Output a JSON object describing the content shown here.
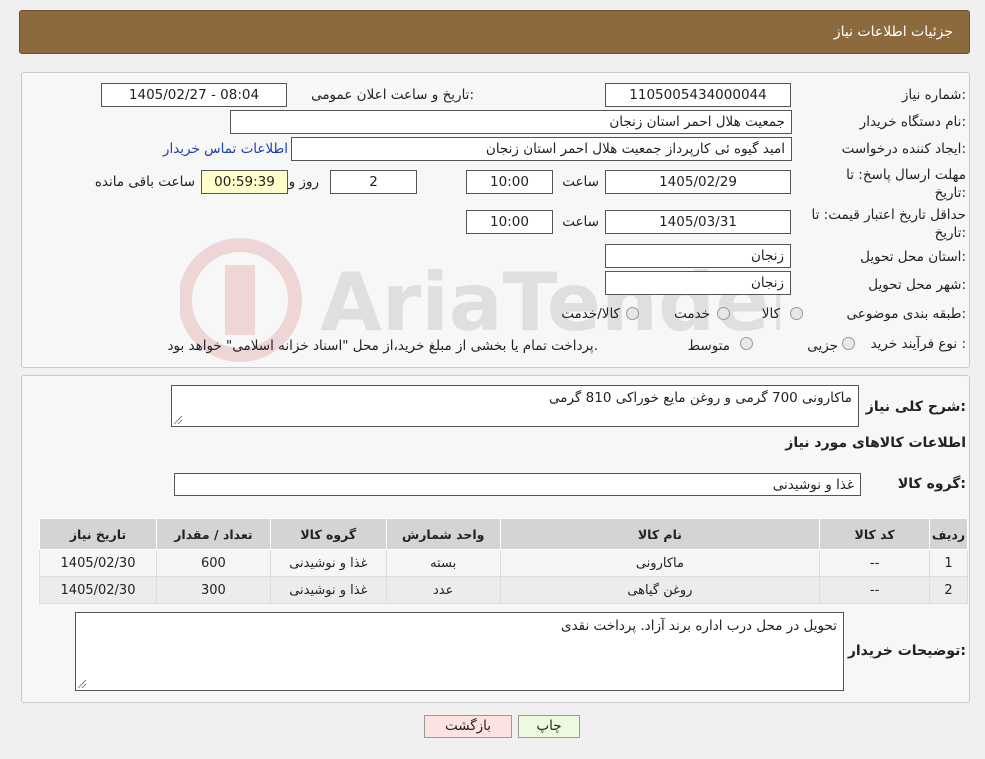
{
  "header": {
    "title": "جزئیات اطلاعات نیاز"
  },
  "form": {
    "need_number_label": "شماره نیاز:",
    "need_number": "1105005434000044",
    "announce_label": "تاریخ و ساعت اعلان عمومی:",
    "announce_value": "1405/02/27 - 08:04",
    "buyer_org_label": "نام دستگاه خریدار:",
    "buyer_org": "جمعیت هلال احمر استان زنجان",
    "requester_label": "ایجاد کننده درخواست:",
    "requester": "امید گیوه ئی کارپرداز  جمعیت هلال احمر استان زنجان",
    "contact_link": "اطلاعات تماس خریدار",
    "deadline_label": "مهلت ارسال پاسخ: تا تاریخ:",
    "deadline_date": "1405/02/29",
    "time_label": "ساعت",
    "deadline_time": "10:00",
    "days_value": "2",
    "days_label": "روز و",
    "remaining_value": "00:59:39",
    "remaining_label": "ساعت باقی مانده",
    "validity_label": "حداقل تاریخ اعتبار قیمت: تا تاریخ:",
    "validity_date": "1405/03/31",
    "validity_time": "10:00",
    "province_label": "استان محل تحویل:",
    "province": "زنجان",
    "city_label": "شهر محل تحویل:",
    "city": "زنجان",
    "category_label": "طبقه بندی موضوعی:",
    "category_options": [
      "کالا",
      "خدمت",
      "کالا/خدمت"
    ],
    "process_label": "نوع فرآیند خرید :",
    "process_options": [
      "جزیی",
      "متوسط"
    ],
    "process_note": "پرداخت تمام یا بخشی از مبلغ خرید،از محل \"اسناد خزانه اسلامی\" خواهد بود."
  },
  "details": {
    "summary_label": "شرح کلی نیاز:",
    "summary": "ماکارونی 700 گرمی و روغن مایع خوراکی 810 گرمی",
    "goods_info_title": "اطلاعات کالاهای مورد نیاز",
    "goods_group_label": "گروه کالا:",
    "goods_group": "غذا و نوشیدنی",
    "table": {
      "headers": [
        "ردیف",
        "کد کالا",
        "نام کالا",
        "واحد شمارش",
        "گروه کالا",
        "تعداد / مقدار",
        "تاریخ نیاز"
      ],
      "rows": [
        [
          "1",
          "--",
          "ماکارونی",
          "بسته",
          "غذا و نوشیدنی",
          "600",
          "1405/02/30"
        ],
        [
          "2",
          "--",
          "روغن گیاهی",
          "عدد",
          "غذا و نوشیدنی",
          "300",
          "1405/02/30"
        ]
      ]
    },
    "buyer_notes_label": "توضیحات خریدار:",
    "buyer_notes": "تحویل در محل درب اداره برند آزاد. پرداخت نقدی"
  },
  "buttons": {
    "print": "چاپ",
    "back": "بازگشت"
  },
  "colors": {
    "header": "#8c6a3d",
    "print_btn": "#eefae0",
    "back_btn": "#fde2e2"
  }
}
